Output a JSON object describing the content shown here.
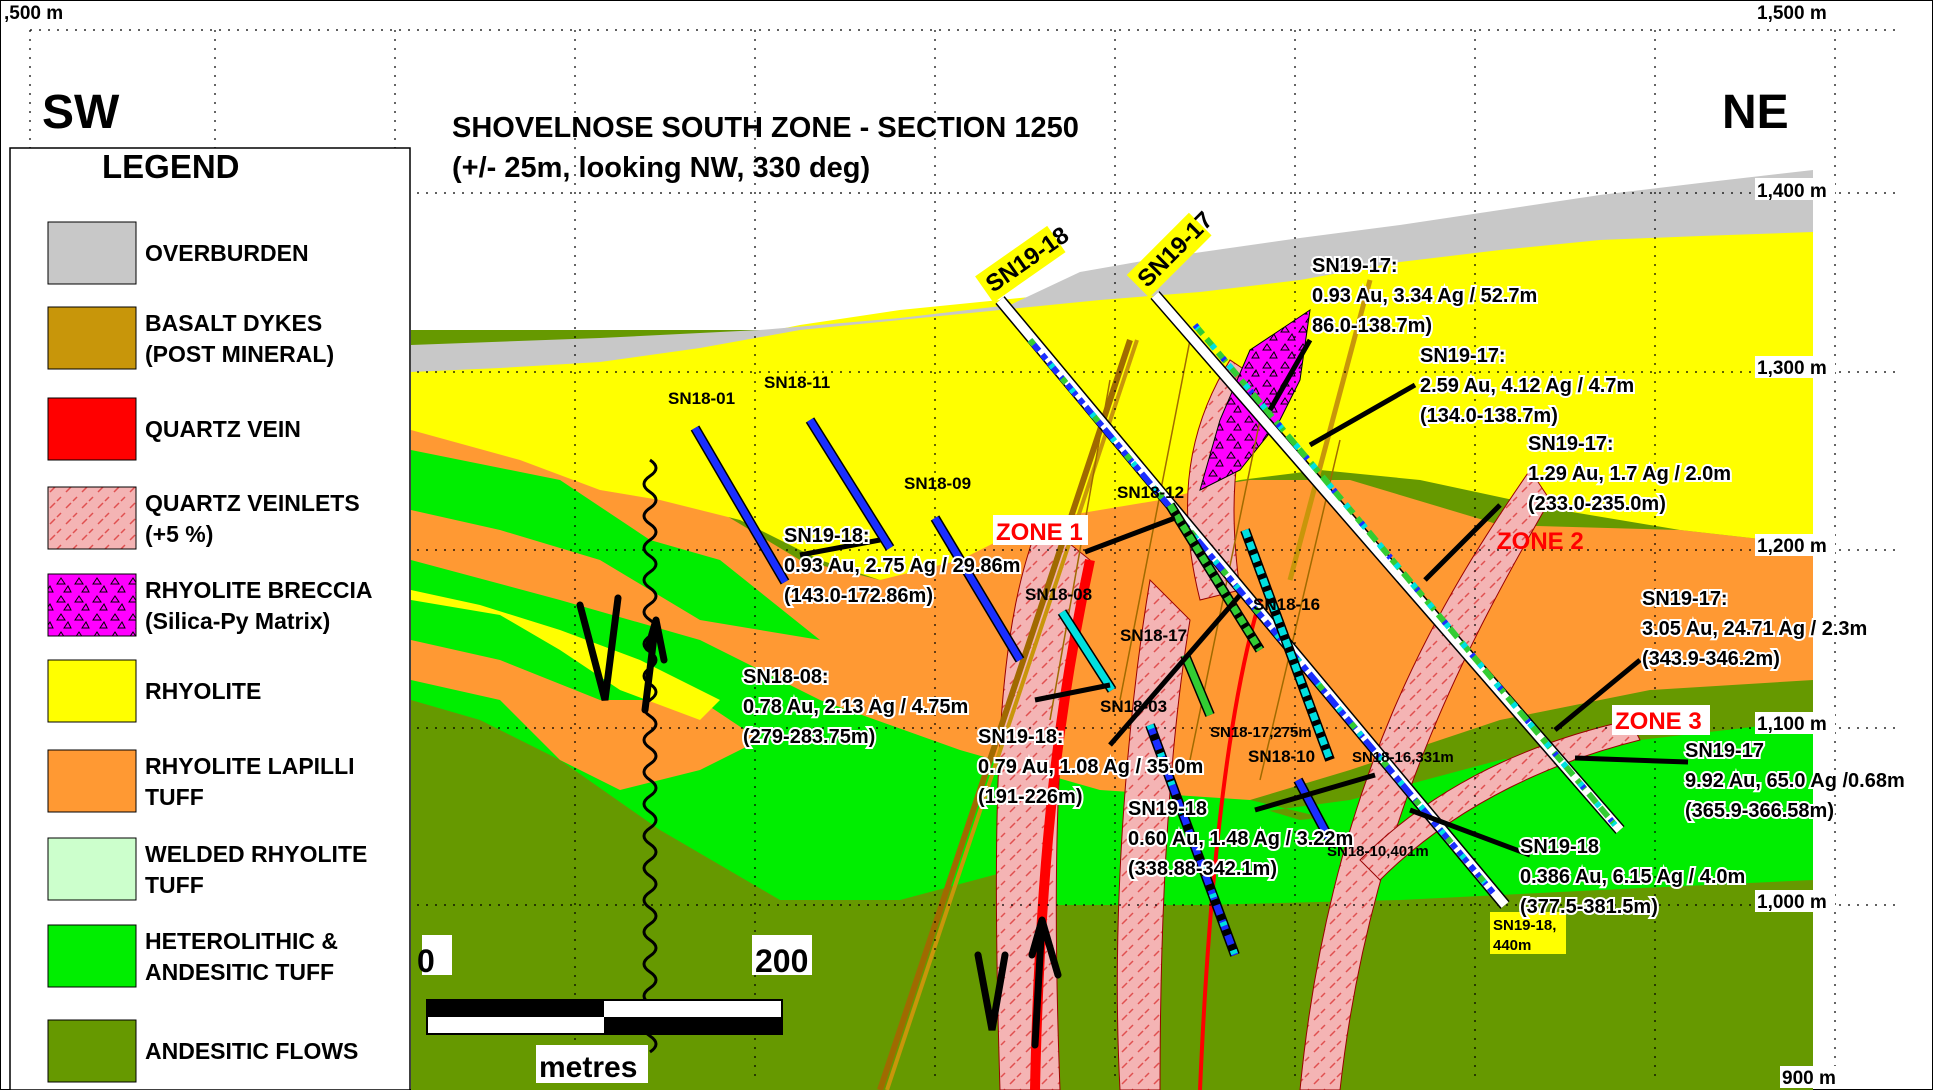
{
  "orientation": {
    "left": "SW",
    "right": "NE"
  },
  "title": {
    "line1": "SHOVELNOSE SOUTH ZONE - SECTION 1250",
    "line2": "(+/- 25m, looking NW, 330 deg)"
  },
  "elevations": {
    "top_left": ",500 m",
    "top_right": "1,500 m",
    "e1400": "1,400 m",
    "e1300": "1,300 m",
    "e1200": "1,200 m",
    "e1100": "1,100 m",
    "e1000": "1,000 m",
    "e900": "900 m"
  },
  "legend": {
    "title": "LEGEND",
    "items": [
      {
        "label1": "OVERBURDEN",
        "label2": "",
        "color": "#c8c8c8"
      },
      {
        "label1": "BASALT DYKES",
        "label2": "(POST MINERAL)",
        "color": "#c8960a"
      },
      {
        "label1": "QUARTZ VEIN",
        "label2": "",
        "color": "#ff0000"
      },
      {
        "label1": "QUARTZ VEINLETS",
        "label2": "(+5 %)",
        "color": "#f4b4b4"
      },
      {
        "label1": "RHYOLITE BRECCIA",
        "label2": "(Silica-Py Matrix)",
        "color": "#ff00ff"
      },
      {
        "label1": "RHYOLITE",
        "label2": "",
        "color": "#ffff00"
      },
      {
        "label1": "RHYOLITE LAPILLI",
        "label2": "TUFF",
        "color": "#ff9933"
      },
      {
        "label1": "WELDED RHYOLITE",
        "label2": "TUFF",
        "color": "#ccffcc"
      },
      {
        "label1": "HETEROLITHIC &",
        "label2": "ANDESITIC TUFF",
        "color": "#00ee00"
      },
      {
        "label1": "ANDESITIC FLOWS",
        "label2": "",
        "color": "#669900"
      }
    ]
  },
  "zones": {
    "z1": "ZONE 1",
    "z2": "ZONE 2",
    "z3": "ZONE 3"
  },
  "holes": {
    "sn19_18": "SN19-18",
    "sn19_17": "SN19-17",
    "sn18_01": "SN18-01",
    "sn18_11": "SN18-11",
    "sn18_09": "SN18-09",
    "sn18_12": "SN18-12",
    "sn18_08": "SN18-08",
    "sn18_17": "SN18-17",
    "sn18_03": "SN18-03",
    "sn18_16": "SN18-16",
    "sn18_17_275": "SN18-17,275m",
    "sn18_10": "SN18-10",
    "sn18_16_331": "SN18-16,331m",
    "sn18_10_401": "SN18-10,401m",
    "sn19_18_end1": "SN19-18,",
    "sn19_18_end2": "440m"
  },
  "intercepts": {
    "a": {
      "l1": "SN19-17:",
      "l2": "0.93 Au, 3.34 Ag / 52.7m",
      "l3": "86.0-138.7m)"
    },
    "b": {
      "l1": "SN19-17:",
      "l2": "2.59 Au, 4.12 Ag / 4.7m",
      "l3": "(134.0-138.7m)"
    },
    "c": {
      "l1": "SN19-17:",
      "l2": "1.29 Au, 1.7 Ag / 2.0m",
      "l3": "(233.0-235.0m)"
    },
    "d": {
      "l1": "SN19-18:",
      "l2": "0.93 Au, 2.75 Ag / 29.86m",
      "l3": "(143.0-172.86m)"
    },
    "e": {
      "l1": "SN19-17:",
      "l2": "3.05 Au, 24.71 Ag / 2.3m",
      "l3": "(343.9-346.2m)"
    },
    "f": {
      "l1": "SN18-08:",
      "l2": "0.78 Au, 2.13 Ag / 4.75m",
      "l3": "(279-283.75m)"
    },
    "g": {
      "l1": "SN19-18:",
      "l2": "0.79 Au, 1.08 Ag / 35.0m",
      "l3": "(191-226m)"
    },
    "h": {
      "l1": "SN19-17",
      "l2": "9.92 Au, 65.0 Ag /0.68m",
      "l3": "(365.9-366.58m)"
    },
    "i": {
      "l1": "SN19-18",
      "l2": "0.60 Au, 1.48 Ag / 3.22m",
      "l3": "(338.88-342.1m)"
    },
    "j": {
      "l1": "SN19-18",
      "l2": "0.386 Au, 6.15 Ag / 4.0m",
      "l3": "(377.5-381.5m)"
    }
  },
  "scale_bar": {
    "start": "0",
    "end": "200",
    "unit": "metres"
  }
}
